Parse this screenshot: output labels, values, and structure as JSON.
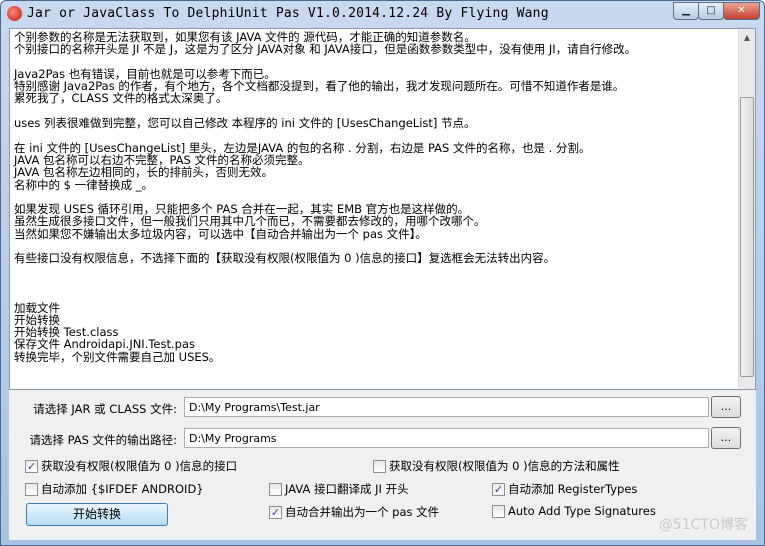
{
  "window": {
    "title": "Jar or JavaClass To DelphiUnit Pas V1.0.2014.12.24 By Flying Wang",
    "minimize": "▁",
    "maximize": "□",
    "close": "✕"
  },
  "log": {
    "lines": [
      "个别参数的名称是无法获取到，如果您有该 JAVA 文件的 源代码，才能正确的知道参数名。",
      "个别接口的名称开头是 JI 不是 J，这是为了区分 JAVA对象 和 JAVA接口，但是函数参数类型中，没有使用 JI，请自行修改。",
      "",
      "Java2Pas 也有错误，目前也就是可以参考下而已。",
      "特别感谢 Java2Pas 的作者，有个地方，各个文档都没提到，看了他的输出，我才发现问题所在。可惜不知道作者是谁。",
      "累死我了，CLASS 文件的格式太深奥了。",
      "",
      "uses 列表很难做到完整，您可以自己修改 本程序的 ini 文件的 [UsesChangeList] 节点。",
      "",
      "在 ini 文件的 [UsesChangeList] 里头，左边是JAVA 的包的名称 . 分割，右边是 PAS 文件的名称，也是 . 分割。",
      "JAVA 包名称可以右边不完整，PAS 文件的名称必须完整。",
      "JAVA 包名称左边相同的，长的排前头，否则无效。",
      "名称中的 $ 一律替换成 _。",
      "",
      "如果发现 USES 循环引用，只能把多个 PAS 合并在一起，其实 EMB 官方也是这样做的。",
      "虽然生成很多接口文件，但一般我们只用其中几个而已，不需要都去修改的，用哪个改哪个。",
      "当然如果您不嫌输出太多垃圾内容，可以选中【自动合并输出为一个 pas 文件】。",
      "",
      "有些接口没有权限信息，不选择下面的【获取没有权限(权限值为 0 )信息的接口】复选框会无法转出内容。",
      "",
      "",
      "",
      "加载文件",
      "开始转换",
      "开始转换 Test.class",
      "保存文件 Androidapi.JNI.Test.pas",
      "转换完毕，个别文件需要自己加 USES。"
    ]
  },
  "form": {
    "jar_label": "请选择 JAR 或 CLASS 文件:",
    "jar_value": "D:\\My Programs\\Test.jar",
    "pas_label": "请选择 PAS 文件的输出路径:",
    "pas_value": "D:\\My Programs",
    "browse": "...",
    "checkboxes": [
      {
        "label": "获取没有权限(权限值为 0 )信息的接口",
        "checked": true
      },
      {
        "label": "获取没有权限(权限值为 0 )信息的方法和属性",
        "checked": false
      },
      {
        "label": "自动添加 {$IFDEF ANDROID}",
        "checked": false
      },
      {
        "label": "JAVA 接口翻译成 JI 开头",
        "checked": false
      },
      {
        "label": "自动添加 RegisterTypes",
        "checked": true
      },
      {
        "label": "自动合并输出为一个 pas 文件",
        "checked": true
      },
      {
        "label": "Auto Add Type Signatures",
        "checked": false
      }
    ],
    "start": "开始转换"
  },
  "watermark": "@51CTO博客"
}
